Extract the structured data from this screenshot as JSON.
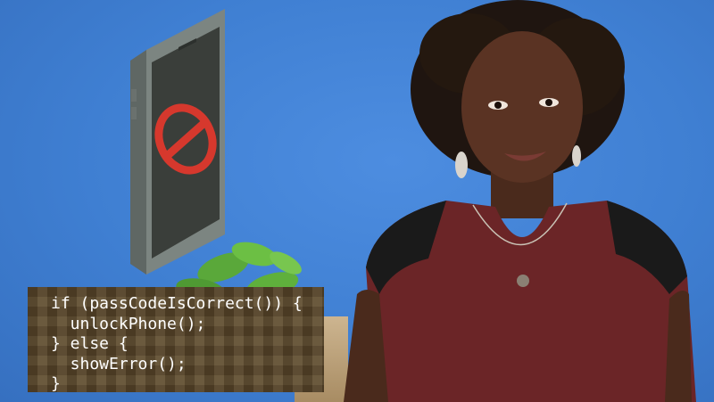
{
  "scene": {
    "background_color": "#3f7fd2"
  },
  "phone_illustration": {
    "icon": "no-entry-icon",
    "symbol_color": "#d6382d",
    "screen_color": "#3a3e3a",
    "body_color": "#7c8581"
  },
  "code_overlay": {
    "lines": [
      "if (passCodeIsCorrect()) {",
      "  unlockPhone();",
      "} else {",
      "  showError();",
      "}"
    ],
    "text_color": "#ffffff"
  },
  "presenter": {
    "description_icon": "person-icon",
    "shirt_color": "#6b2527"
  }
}
